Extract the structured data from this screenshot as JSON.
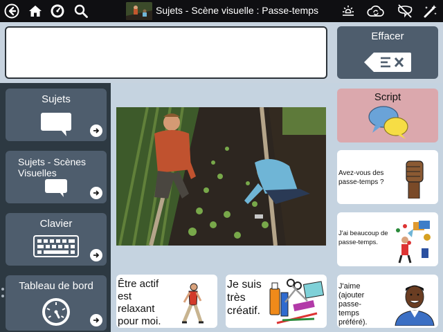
{
  "topbar": {
    "title": "Sujets - Scène visuelle : Passe-temps",
    "icons": [
      "back-icon",
      "home-icon",
      "dashboard-icon",
      "search-icon",
      "brightness-icon",
      "sync-icon",
      "speech-off-icon",
      "edit-wand-icon"
    ]
  },
  "message": {
    "value": ""
  },
  "erase": {
    "label": "Effacer"
  },
  "sidebar": {
    "items": [
      {
        "label": "Sujets"
      },
      {
        "label": "Sujets - Scènes Visuelles"
      },
      {
        "label": "Clavier"
      },
      {
        "label": "Tableau de bord"
      }
    ]
  },
  "script": {
    "label": "Script"
  },
  "phrases": [
    {
      "text": "Avez-vous des passe-temps ?"
    },
    {
      "text": "J'ai beaucoup de passe-temps."
    },
    {
      "text": "J'aime (ajouter passe-temps préféré)."
    }
  ],
  "cards": [
    {
      "text": "Être actif est relaxant pour moi."
    },
    {
      "text": "Je suis très créatif."
    }
  ],
  "colors": {
    "topbar": "#0f0f12",
    "panel": "#4e5d6d",
    "sidebar": "#2d3942",
    "background": "#c5d3e0",
    "script": "#dba8ad"
  }
}
